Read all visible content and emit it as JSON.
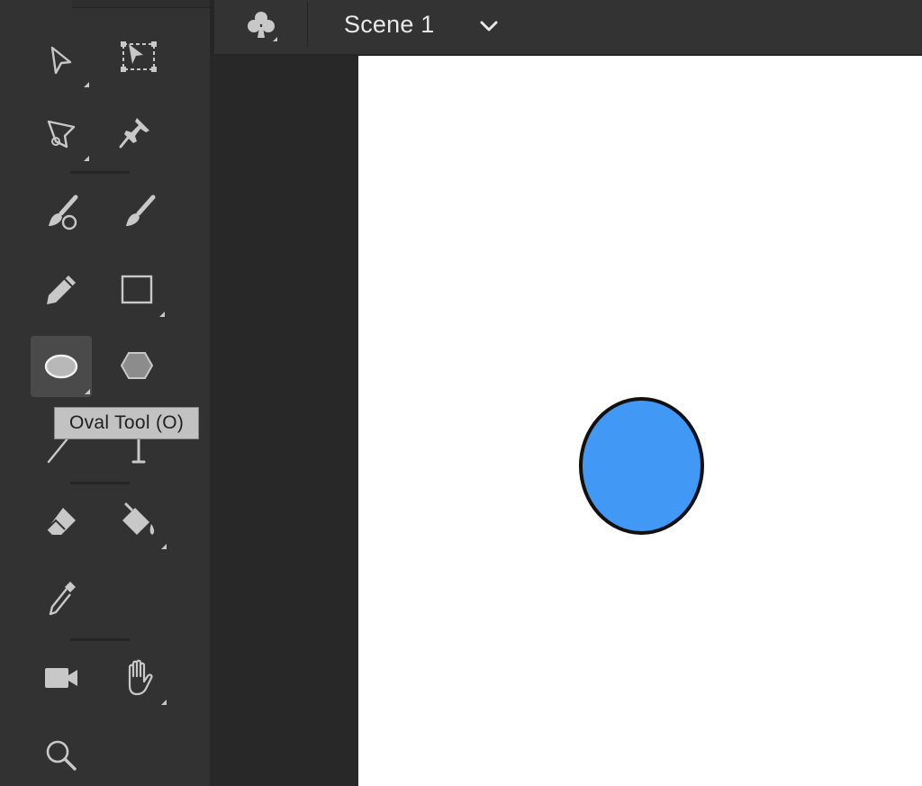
{
  "tooltip": {
    "text": "Oval Tool (O)"
  },
  "edit_bar": {
    "scene_name": "Scene 1",
    "symbol_icon": "club-icon",
    "dropdown_icon": "chevron-down-icon"
  },
  "tools": {
    "groups": [
      [
        "selection-tool",
        "free-transform-tool",
        "lasso-tool",
        "pin-tool"
      ],
      [
        "paint-brush-tool",
        "brush-tool",
        "pencil-tool",
        "rectangle-tool",
        "oval-tool",
        "polystar-tool",
        "line-tool",
        "text-tool"
      ],
      [
        "eraser-tool",
        "paint-bucket-tool",
        "eyedropper-tool"
      ],
      [
        "camera-tool",
        "hand-tool",
        "zoom-tool"
      ]
    ],
    "active": "oval-tool"
  },
  "stage": {
    "background": "#ffffff",
    "shape": {
      "type": "oval",
      "fill": "#4299f5",
      "stroke": "#111111"
    }
  },
  "colors": {
    "panel": "#323232",
    "pasteboard": "#282828",
    "icon": "#c8c8c8",
    "tooltip_bg": "#c2c2c2"
  }
}
